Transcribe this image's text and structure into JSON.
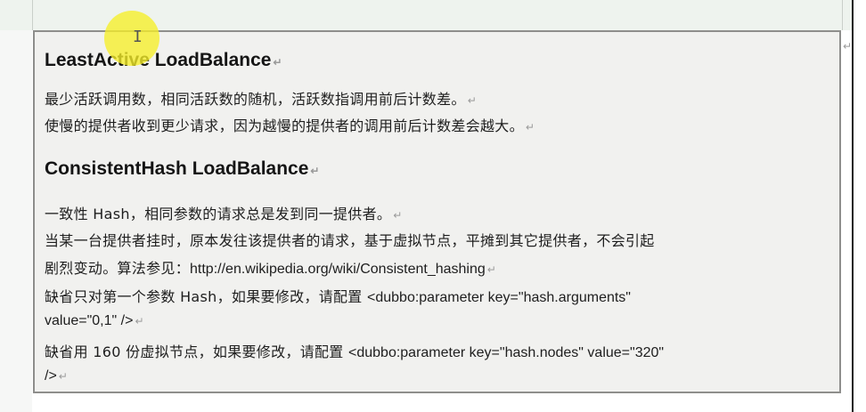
{
  "doc": {
    "heading1": "LeastActive LoadBalance",
    "para1_line1": "最少活跃调用数，相同活跃数的随机，活跃数指调用前后计数差。",
    "para1_line2": "使慢的提供者收到更少请求，因为越慢的提供者的调用前后计数差会越大。",
    "heading2": "ConsistentHash LoadBalance",
    "para2_line1": "一致性 Hash，相同参数的请求总是发到同一提供者。",
    "para2_line2": "当某一台提供者挂时，原本发往该提供者的请求，基于虚拟节点，平摊到其它提供者，不会引起",
    "para2_line3_cn": "剧烈变动。算法参见：",
    "para2_line3_url": "http://en.wikipedia.org/wiki/Consistent_hashing",
    "para2_line4_cn": "缺省只对第一个参数 Hash，如果要修改，请配置 ",
    "para2_line4_code": "<dubbo:parameter key=\"hash.arguments\"",
    "para2_line5": "value=\"0,1\" />",
    "para2_line6_cn": "缺省用 160 份虚拟节点，如果要修改，请配置 ",
    "para2_line6_code": "<dubbo:parameter key=\"hash.nodes\" value=\"320\"",
    "para2_line7": "/>",
    "paragraph_mark": "↵",
    "cursor_glyph": "I"
  },
  "colors": {
    "cell_background": "#f1f1ef",
    "cell_border": "#8e8e8c",
    "top_band": "#eef3ee",
    "cursor_highlight": "#f6ee28"
  }
}
